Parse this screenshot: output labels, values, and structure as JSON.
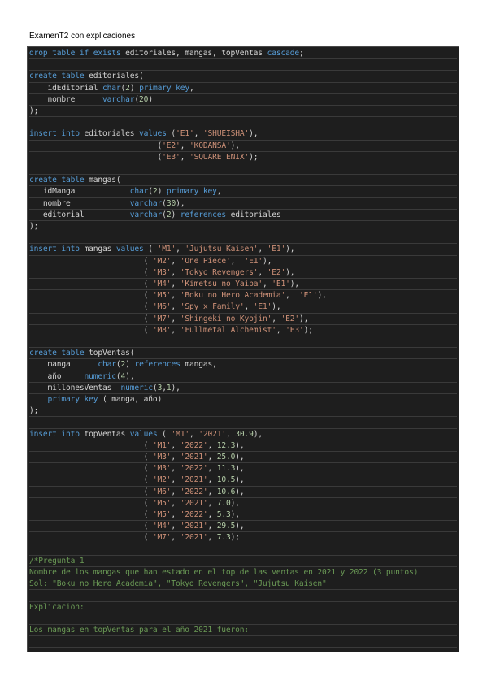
{
  "document": {
    "title": "ExamenT2 con explicaciones"
  },
  "code": {
    "lines": [
      [
        [
          "kw",
          "drop table if exists "
        ],
        [
          "tx",
          "editoriales, mangas, topVentas "
        ],
        [
          "kw",
          "cascade"
        ],
        [
          "tx",
          ";"
        ]
      ],
      [],
      [
        [
          "kw",
          "create table "
        ],
        [
          "tx",
          "editoriales("
        ]
      ],
      [
        [
          "tx",
          "    idEditorial "
        ],
        [
          "kw",
          "char"
        ],
        [
          "tx",
          "("
        ],
        [
          "num",
          "2"
        ],
        [
          "tx",
          ") "
        ],
        [
          "kw",
          "primary key"
        ],
        [
          "tx",
          ","
        ]
      ],
      [
        [
          "tx",
          "    nombre      "
        ],
        [
          "kw",
          "varchar"
        ],
        [
          "tx",
          "("
        ],
        [
          "num",
          "20"
        ],
        [
          "tx",
          ")"
        ]
      ],
      [
        [
          "tx",
          ");"
        ]
      ],
      [],
      [
        [
          "kw",
          "insert into "
        ],
        [
          "tx",
          "editoriales "
        ],
        [
          "kw",
          "values "
        ],
        [
          "tx",
          "("
        ],
        [
          "str",
          "'E1'"
        ],
        [
          "tx",
          ", "
        ],
        [
          "str",
          "'SHUEISHA'"
        ],
        [
          "tx",
          "),"
        ]
      ],
      [
        [
          "tx",
          "                            ("
        ],
        [
          "str",
          "'E2'"
        ],
        [
          "tx",
          ", "
        ],
        [
          "str",
          "'KODANSA'"
        ],
        [
          "tx",
          "),"
        ]
      ],
      [
        [
          "tx",
          "                            ("
        ],
        [
          "str",
          "'E3'"
        ],
        [
          "tx",
          ", "
        ],
        [
          "str",
          "'SQUARE ENIX'"
        ],
        [
          "tx",
          ");"
        ]
      ],
      [],
      [
        [
          "kw",
          "create table "
        ],
        [
          "tx",
          "mangas("
        ]
      ],
      [
        [
          "tx",
          "   idManga            "
        ],
        [
          "kw",
          "char"
        ],
        [
          "tx",
          "("
        ],
        [
          "num",
          "2"
        ],
        [
          "tx",
          ") "
        ],
        [
          "kw",
          "primary key"
        ],
        [
          "tx",
          ","
        ]
      ],
      [
        [
          "tx",
          "   nombre             "
        ],
        [
          "kw",
          "varchar"
        ],
        [
          "tx",
          "("
        ],
        [
          "num",
          "30"
        ],
        [
          "tx",
          "),"
        ]
      ],
      [
        [
          "tx",
          "   editorial          "
        ],
        [
          "kw",
          "varchar"
        ],
        [
          "tx",
          "("
        ],
        [
          "num",
          "2"
        ],
        [
          "tx",
          ") "
        ],
        [
          "kw",
          "references "
        ],
        [
          "tx",
          "editoriales"
        ]
      ],
      [
        [
          "tx",
          ");"
        ]
      ],
      [],
      [
        [
          "kw",
          "insert into "
        ],
        [
          "tx",
          "mangas "
        ],
        [
          "kw",
          "values "
        ],
        [
          "tx",
          "( "
        ],
        [
          "str",
          "'M1'"
        ],
        [
          "tx",
          ", "
        ],
        [
          "str",
          "'Jujutsu Kaisen'"
        ],
        [
          "tx",
          ", "
        ],
        [
          "str",
          "'E1'"
        ],
        [
          "tx",
          "),"
        ]
      ],
      [
        [
          "tx",
          "                         ( "
        ],
        [
          "str",
          "'M2'"
        ],
        [
          "tx",
          ", "
        ],
        [
          "str",
          "'One Piece'"
        ],
        [
          "tx",
          ",  "
        ],
        [
          "str",
          "'E1'"
        ],
        [
          "tx",
          "),"
        ]
      ],
      [
        [
          "tx",
          "                         ( "
        ],
        [
          "str",
          "'M3'"
        ],
        [
          "tx",
          ", "
        ],
        [
          "str",
          "'Tokyo Revengers'"
        ],
        [
          "tx",
          ", "
        ],
        [
          "str",
          "'E2'"
        ],
        [
          "tx",
          "),"
        ]
      ],
      [
        [
          "tx",
          "                         ( "
        ],
        [
          "str",
          "'M4'"
        ],
        [
          "tx",
          ", "
        ],
        [
          "str",
          "'Kimetsu no Yaiba'"
        ],
        [
          "tx",
          ", "
        ],
        [
          "str",
          "'E1'"
        ],
        [
          "tx",
          "),"
        ]
      ],
      [
        [
          "tx",
          "                         ( "
        ],
        [
          "str",
          "'M5'"
        ],
        [
          "tx",
          ", "
        ],
        [
          "str",
          "'Boku no Hero Academia'"
        ],
        [
          "tx",
          ",  "
        ],
        [
          "str",
          "'E1'"
        ],
        [
          "tx",
          "),"
        ]
      ],
      [
        [
          "tx",
          "                         ( "
        ],
        [
          "str",
          "'M6'"
        ],
        [
          "tx",
          ", "
        ],
        [
          "str",
          "'Spy x Family'"
        ],
        [
          "tx",
          ", "
        ],
        [
          "str",
          "'E1'"
        ],
        [
          "tx",
          "),"
        ]
      ],
      [
        [
          "tx",
          "                         ( "
        ],
        [
          "str",
          "'M7'"
        ],
        [
          "tx",
          ", "
        ],
        [
          "str",
          "'Shingeki no Kyojin'"
        ],
        [
          "tx",
          ", "
        ],
        [
          "str",
          "'E2'"
        ],
        [
          "tx",
          "),"
        ]
      ],
      [
        [
          "tx",
          "                         ( "
        ],
        [
          "str",
          "'M8'"
        ],
        [
          "tx",
          ", "
        ],
        [
          "str",
          "'Fullmetal Alchemist'"
        ],
        [
          "tx",
          ", "
        ],
        [
          "str",
          "'E3'"
        ],
        [
          "tx",
          ");"
        ]
      ],
      [],
      [
        [
          "kw",
          "create table "
        ],
        [
          "tx",
          "topVentas("
        ]
      ],
      [
        [
          "tx",
          "    manga      "
        ],
        [
          "kw",
          "char"
        ],
        [
          "tx",
          "("
        ],
        [
          "num",
          "2"
        ],
        [
          "tx",
          ") "
        ],
        [
          "kw",
          "references "
        ],
        [
          "tx",
          "mangas,"
        ]
      ],
      [
        [
          "tx",
          "    año     "
        ],
        [
          "kw",
          "numeric"
        ],
        [
          "tx",
          "("
        ],
        [
          "num",
          "4"
        ],
        [
          "tx",
          "),"
        ]
      ],
      [
        [
          "tx",
          "    millonesVentas  "
        ],
        [
          "kw",
          "numeric"
        ],
        [
          "tx",
          "("
        ],
        [
          "num",
          "3"
        ],
        [
          "tx",
          ","
        ],
        [
          "num",
          "1"
        ],
        [
          "tx",
          "),"
        ]
      ],
      [
        [
          "tx",
          "    "
        ],
        [
          "kw",
          "primary key "
        ],
        [
          "tx",
          "( manga, año)"
        ]
      ],
      [
        [
          "tx",
          ");"
        ]
      ],
      [],
      [
        [
          "kw",
          "insert into "
        ],
        [
          "tx",
          "topVentas "
        ],
        [
          "kw",
          "values "
        ],
        [
          "tx",
          "( "
        ],
        [
          "str",
          "'M1'"
        ],
        [
          "tx",
          ", "
        ],
        [
          "str",
          "'2021'"
        ],
        [
          "tx",
          ", "
        ],
        [
          "num",
          "30.9"
        ],
        [
          "tx",
          "),"
        ]
      ],
      [
        [
          "tx",
          "                         ( "
        ],
        [
          "str",
          "'M1'"
        ],
        [
          "tx",
          ", "
        ],
        [
          "str",
          "'2022'"
        ],
        [
          "tx",
          ", "
        ],
        [
          "num",
          "12.3"
        ],
        [
          "tx",
          "),"
        ]
      ],
      [
        [
          "tx",
          "                         ( "
        ],
        [
          "str",
          "'M3'"
        ],
        [
          "tx",
          ", "
        ],
        [
          "str",
          "'2021'"
        ],
        [
          "tx",
          ", "
        ],
        [
          "num",
          "25.0"
        ],
        [
          "tx",
          "),"
        ]
      ],
      [
        [
          "tx",
          "                         ( "
        ],
        [
          "str",
          "'M3'"
        ],
        [
          "tx",
          ", "
        ],
        [
          "str",
          "'2022'"
        ],
        [
          "tx",
          ", "
        ],
        [
          "num",
          "11.3"
        ],
        [
          "tx",
          "),"
        ]
      ],
      [
        [
          "tx",
          "                         ( "
        ],
        [
          "str",
          "'M2'"
        ],
        [
          "tx",
          ", "
        ],
        [
          "str",
          "'2021'"
        ],
        [
          "tx",
          ", "
        ],
        [
          "num",
          "10.5"
        ],
        [
          "tx",
          "),"
        ]
      ],
      [
        [
          "tx",
          "                         ( "
        ],
        [
          "str",
          "'M6'"
        ],
        [
          "tx",
          ", "
        ],
        [
          "str",
          "'2022'"
        ],
        [
          "tx",
          ", "
        ],
        [
          "num",
          "10.6"
        ],
        [
          "tx",
          "),"
        ]
      ],
      [
        [
          "tx",
          "                         ( "
        ],
        [
          "str",
          "'M5'"
        ],
        [
          "tx",
          ", "
        ],
        [
          "str",
          "'2021'"
        ],
        [
          "tx",
          ", "
        ],
        [
          "num",
          "7.0"
        ],
        [
          "tx",
          "),"
        ]
      ],
      [
        [
          "tx",
          "                         ( "
        ],
        [
          "str",
          "'M5'"
        ],
        [
          "tx",
          ", "
        ],
        [
          "str",
          "'2022'"
        ],
        [
          "tx",
          ", "
        ],
        [
          "num",
          "5.3"
        ],
        [
          "tx",
          "),"
        ]
      ],
      [
        [
          "tx",
          "                         ( "
        ],
        [
          "str",
          "'M4'"
        ],
        [
          "tx",
          ", "
        ],
        [
          "str",
          "'2021'"
        ],
        [
          "tx",
          ", "
        ],
        [
          "num",
          "29.5"
        ],
        [
          "tx",
          "),"
        ]
      ],
      [
        [
          "tx",
          "                         ( "
        ],
        [
          "str",
          "'M7'"
        ],
        [
          "tx",
          ", "
        ],
        [
          "str",
          "'2021'"
        ],
        [
          "tx",
          ", "
        ],
        [
          "num",
          "7.3"
        ],
        [
          "tx",
          ");"
        ]
      ],
      [],
      [
        [
          "cm",
          "/*Pregunta 1"
        ]
      ],
      [
        [
          "cm",
          "Nombre de los mangas que han estado en el top de las ventas en 2021 y 2022 (3 puntos)"
        ]
      ],
      [
        [
          "cm",
          "Sol: \"Boku no Hero Academia\", \"Tokyo Revengers\", \"Jujutsu Kaisen\""
        ]
      ],
      [],
      [
        [
          "cm",
          "Explicacion:"
        ]
      ],
      [],
      [
        [
          "cm",
          "Los mangas en topVentas para el año 2021 fueron:"
        ]
      ],
      []
    ]
  },
  "colors": {
    "background": "#1e1e1e",
    "keyword": "#569cd6",
    "string": "#ce9178",
    "number": "#b5cea8",
    "text": "#d4d4d4",
    "comment": "#6a9955"
  }
}
